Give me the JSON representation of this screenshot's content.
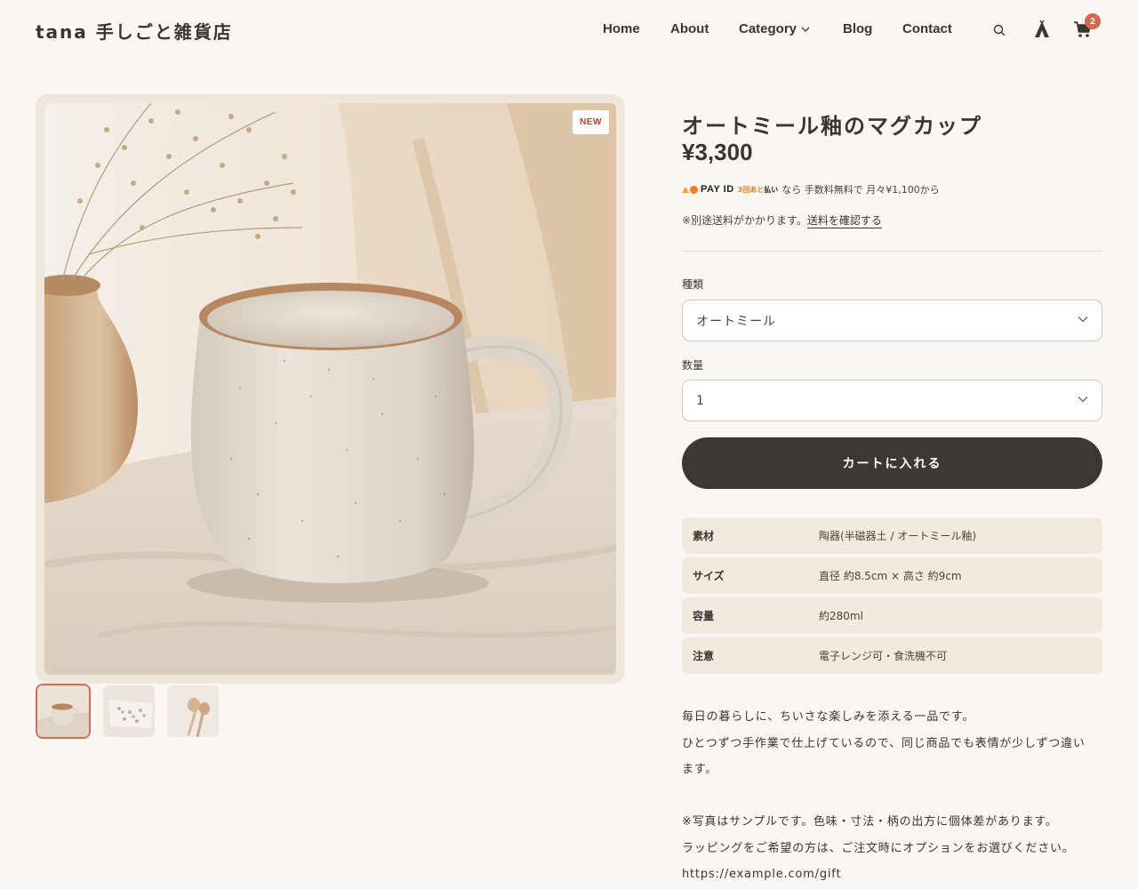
{
  "header": {
    "logo": "tana 手しごと雑貨店",
    "nav": {
      "home": "Home",
      "about": "About",
      "category": "Category",
      "blog": "Blog",
      "contact": "Contact"
    },
    "cart_count": "2"
  },
  "product": {
    "badge": "NEW",
    "title": "オートミール釉のマグカップ",
    "price": "¥3,300",
    "payment": {
      "brand": "PAY ID",
      "sub_highlight": "3回あと",
      "sub_rest": "払い",
      "text": "なら 手数料無料で 月々¥1,100から"
    },
    "shipping": {
      "text": "※別途送料がかかります。",
      "link": "送料を確認する"
    },
    "options": {
      "type_label": "種類",
      "type_value": "オートミール",
      "qty_label": "数量",
      "qty_value": "1"
    },
    "add_to_cart": "カートに入れる",
    "specs": [
      {
        "key": "素材",
        "value": "陶器(半磁器土 / オートミール釉)"
      },
      {
        "key": "サイズ",
        "value": "直径 約8.5cm × 高さ 約9cm"
      },
      {
        "key": "容量",
        "value": "約280ml"
      },
      {
        "key": "注意",
        "value": "電子レンジ可・食洗機不可"
      }
    ],
    "description": {
      "line1": "毎日の暮らしに、ちいさな楽しみを添える一品です。",
      "line2": "ひとつずつ手作業で仕上げているので、同じ商品でも表情が少しずつ違い",
      "line3": "ます。",
      "line4": "※写真はサンプルです。色味・寸法・柄の出方に個体差があります。",
      "line5": "ラッピングをご希望の方は、ご注文時にオプションをお選びください。",
      "line6": "https://example.com/gift"
    }
  },
  "colors": {
    "background": "#faf7f3",
    "accent": "#d9664a",
    "button": "#3e3834",
    "spec_row": "#f2e9df"
  }
}
